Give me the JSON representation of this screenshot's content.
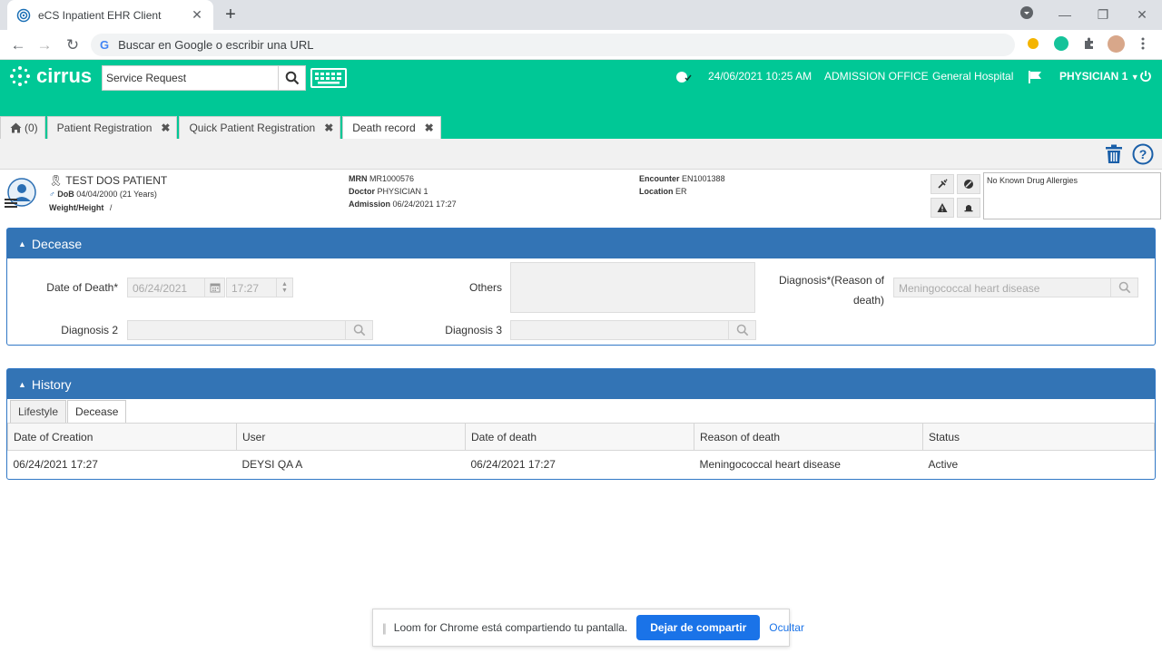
{
  "browser": {
    "tab_title": "eCS Inpatient EHR Client",
    "omnibox_placeholder": "Buscar en Google o escribir una URL"
  },
  "header": {
    "logo_text": "cirrus",
    "search_value": "Service Request",
    "datetime": "24/06/2021 10:25 AM",
    "office": "ADMISSION OFFICE",
    "hospital": "General Hospital",
    "user": "PHYSICIAN 1",
    "brand_color": "#00c896"
  },
  "app_tabs": [
    {
      "label": "(0)",
      "icon": "home-icon"
    },
    {
      "label": "Patient Registration"
    },
    {
      "label": "Quick Patient Registration"
    },
    {
      "label": "Death record"
    }
  ],
  "patient": {
    "name": "TEST DOS PATIENT",
    "dob_label": "DoB",
    "dob_value": "04/04/2000 (21 Years)",
    "weight_height_label": "Weight/Height",
    "weight_height_value": "/",
    "mrn_label": "MRN",
    "mrn_value": "MR1000576",
    "doctor_label": "Doctor",
    "doctor_value": "PHYSICIAN 1",
    "admission_label": "Admission",
    "admission_value": "06/24/2021 17:27",
    "encounter_label": "Encounter",
    "encounter_value": "EN1001388",
    "location_label": "Location",
    "location_value": "ER",
    "allergies": "No Known Drug Allergies"
  },
  "decease": {
    "title": "Decease",
    "date_of_death_label": "Date of Death*",
    "date_value": "06/24/2021",
    "time_value": "17:27",
    "others_label": "Others",
    "diagnosis_label_1": "Diagnosis*(Reason of",
    "diagnosis_label_2": "death)",
    "diagnosis_value": "Meningococcal heart disease",
    "diagnosis2_label": "Diagnosis 2",
    "diagnosis3_label": "Diagnosis 3"
  },
  "history": {
    "title": "History",
    "tabs": [
      "Lifestyle",
      "Decease"
    ],
    "columns": [
      "Date of Creation",
      "User",
      "Date of death",
      "Reason of death",
      "Status"
    ],
    "rows": [
      [
        "06/24/2021 17:27",
        "DEYSI QA A",
        "06/24/2021 17:27",
        "Meningococcal heart disease",
        "Active"
      ]
    ]
  },
  "loom": {
    "message": "Loom for Chrome está compartiendo tu pantalla.",
    "stop_label": "Dejar de compartir",
    "hide_label": "Ocultar"
  }
}
